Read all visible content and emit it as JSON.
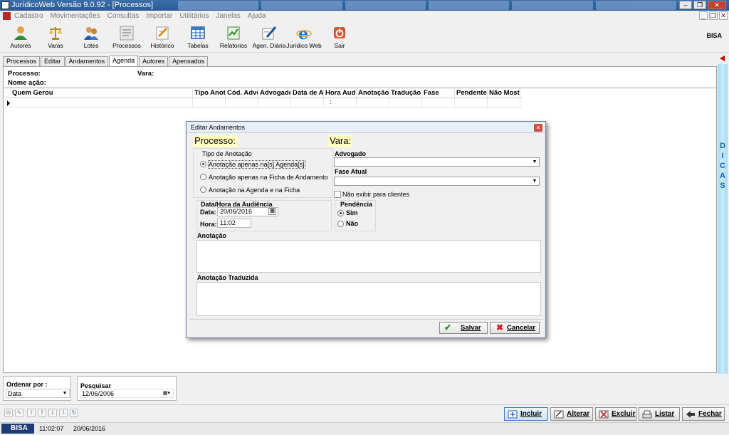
{
  "window": {
    "title": "JurídicoWeb Versão 9.0.92 - [Processos]"
  },
  "menu": [
    "Cadastro",
    "Movimentações",
    "Consultas",
    "Importar",
    "Utilitários",
    "Janelas",
    "Ajuda"
  ],
  "toolbar": [
    {
      "label": "Autores",
      "icon": "person-icon"
    },
    {
      "label": "Varas",
      "icon": "scales-icon"
    },
    {
      "label": "Lotes",
      "icon": "people-icon"
    },
    {
      "label": "Processos",
      "icon": "document-icon"
    },
    {
      "label": "Histórico",
      "icon": "history-icon"
    },
    {
      "label": "Tabelas",
      "icon": "table-icon"
    },
    {
      "label": "Relatorios",
      "icon": "report-icon"
    },
    {
      "label": "Agen. Diária",
      "icon": "agenda-icon"
    },
    {
      "label": "Jurídico Web",
      "icon": "internet-explorer-icon"
    },
    {
      "label": "Sair",
      "icon": "power-icon"
    }
  ],
  "brand": "BISA",
  "tabs": [
    "Processos",
    "Editar",
    "Andamentos",
    "Agenda",
    "Autores",
    "Apensados"
  ],
  "active_tab": "Agenda",
  "info": {
    "processo_label": "Processo:",
    "vara_label": "Vara:",
    "nome_acao_label": "Nome ação:"
  },
  "grid_columns": [
    "Quem Gerou",
    "Tipo Anot",
    "Cód. Adve",
    "Advogado",
    "Data de A",
    "Hora Aud",
    "Anotação",
    "Tradução",
    "Fase",
    "Pendente",
    "Não Mostr"
  ],
  "grid_row": {
    "hora_aud": ":"
  },
  "dicas": "DICAS",
  "dialog": {
    "title": "Editar Andamentos",
    "processo": "Processo:",
    "vara": "Vara:",
    "tipo_anotacao_label": "Tipo de Anotação",
    "radio_options": [
      "Anotação apenas na[s] Agenda[s]",
      "Anotação apenas na Ficha de Andamento",
      "Anotação na Agenda e na Ficha"
    ],
    "radio_selected": 0,
    "advogado_label": "Advogado",
    "advogado_value": "",
    "fase_label": "Fase Atual",
    "fase_value": "",
    "nao_exibir_label": "Não exibir para clientes",
    "nao_exibir_checked": false,
    "audiencia_label": "Data/Hora da Audiência",
    "data_label": "Data:",
    "data_value": "20/06/2016",
    "hora_label": "Hora:",
    "hora_value": "11:02",
    "pendencia_label": "Pendência",
    "pendencia_options": [
      "Sim",
      "Não"
    ],
    "pendencia_selected": 0,
    "anotacao_label": "Anotação",
    "anotacao_traduzida_label": "Anotação Traduzida",
    "salvar": "Salvar",
    "cancelar": "Cancelar"
  },
  "bottom": {
    "ordenar_label": "Ordenar por :",
    "ordenar_value": "Data",
    "pesquisar_label": "Pesquisar",
    "pesquisar_value": "12/06/2006"
  },
  "actions": [
    "Incluir",
    "Alterar",
    "Excluir",
    "Listar",
    "Fechar"
  ],
  "status": {
    "logo": "BISA",
    "time": "11:02:07",
    "date": "20/06/2016"
  }
}
